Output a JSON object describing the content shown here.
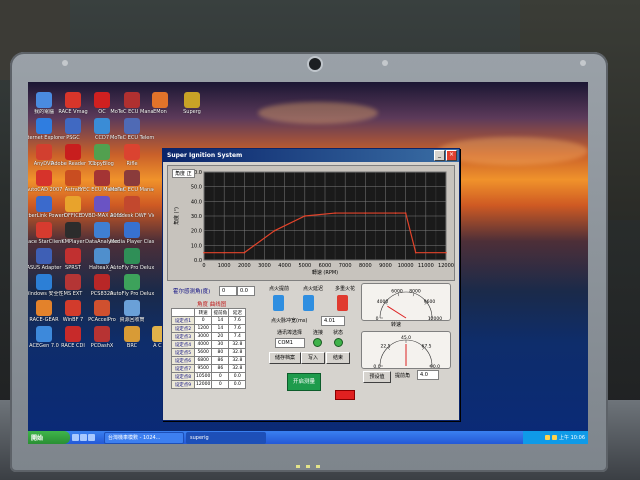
{
  "window": {
    "title": "Super Ignition System"
  },
  "chart_data": {
    "type": "line",
    "title": "",
    "xlabel": "轉速 (RPM)",
    "ylabel": "角度 (°)",
    "x_ticks": [
      "0",
      "1000",
      "2000",
      "3000",
      "4000",
      "5000",
      "6000",
      "7000",
      "8000",
      "9000",
      "10000",
      "11000",
      "12000"
    ],
    "y_ticks": [
      "0.0",
      "10.0",
      "20.0",
      "30.0",
      "40.0",
      "50.0",
      "60.0"
    ],
    "xlim": [
      0,
      12000
    ],
    "ylim": [
      0,
      60
    ],
    "grid": true,
    "series": [
      {
        "x": [
          0,
          1000,
          2000,
          3500,
          5000,
          6500,
          8000,
          9500,
          10000,
          10500,
          12000
        ],
        "y": [
          5,
          5,
          5,
          20,
          30,
          32,
          32,
          32,
          32,
          5,
          5
        ]
      }
    ],
    "legend_box": "角度 正"
  },
  "labels": {
    "sensor_angle": "霍尔感测角(度)",
    "sensor_value": "0",
    "sensor_value2": "0.0",
    "advance_curve": "角度  曲线图",
    "ignite_advance": "点火提前",
    "ignite_delay": "点火延迟",
    "spark_mode": "多重火花",
    "dwell_time": "点火脉冲宽(ms)",
    "dwell_value": "4.01",
    "port_select": "通讯埠选择",
    "port_value": "COM1",
    "connect": "连接",
    "status": "状态",
    "rpm_label": "转速",
    "advance_label": "提前角",
    "advance_value": "4.0"
  },
  "table": {
    "headers": [
      "",
      "转速",
      "提前角",
      "延迟"
    ],
    "rows": [
      [
        "设定点1",
        "0",
        "14",
        "7.6"
      ],
      [
        "设定点2",
        "1200",
        "14",
        "7.6"
      ],
      [
        "设定点3",
        "3000",
        "20",
        "7.4"
      ],
      [
        "设定点4",
        "4000",
        "30",
        "32.8"
      ],
      [
        "设定点5",
        "5600",
        "80",
        "32.8"
      ],
      [
        "设定点6",
        "6800",
        "86",
        "32.8"
      ],
      [
        "设定点7",
        "9500",
        "86",
        "32.8"
      ],
      [
        "设定点8",
        "10500",
        "0",
        "0.0"
      ],
      [
        "设定点9",
        "12000",
        "0",
        "0.0"
      ]
    ]
  },
  "buttons": {
    "open_file": "读取设定",
    "save_file": "储存档案",
    "write": "写入",
    "apply": "开启测量",
    "exit": "结束",
    "load_default": "预设值"
  },
  "gauge_top": {
    "label": "转速",
    "ticks": [
      "0",
      "4000",
      "6000",
      "8000",
      "9600",
      "12000"
    ],
    "value_fraction": 0.18
  },
  "gauge_bottom": {
    "label": "提前角",
    "ticks": [
      "0.0",
      "22.5",
      "45.0",
      "67.5",
      "90.0"
    ],
    "value_fraction": 0.5
  },
  "desktop_icons": [
    {
      "label": "我的電腦",
      "color": "#4a8be0"
    },
    {
      "label": "RACE Vmag",
      "color": "#d8352a"
    },
    {
      "label": "OC",
      "color": "#d02020"
    },
    {
      "label": "MoTeC ECU Mana",
      "color": "#b03030"
    },
    {
      "label": "EMon",
      "color": "#e2732a"
    },
    {
      "label": "Superg",
      "color": "#c9a226"
    },
    {
      "label": "Internet Explorer",
      "color": "#2f7de0"
    },
    {
      "label": "PSGC",
      "color": "#4069c2"
    },
    {
      "label": "CCD7",
      "color": "#3a8cd6"
    },
    {
      "label": "MoTeC ECU Telemtry",
      "color": "#4f6ab5"
    },
    {
      "label": "AnyDVD",
      "color": "#d23f2f"
    },
    {
      "label": "Adobe Reader 7.0",
      "color": "#c81e1e"
    },
    {
      "label": "CopyBlog",
      "color": "#52a04f"
    },
    {
      "label": "Rifle",
      "color": "#db4330"
    },
    {
      "label": "AutoCAD 2007",
      "color": "#d6332b"
    },
    {
      "label": "AstraB",
      "color": "#c94d20"
    },
    {
      "label": "YEC ECU Matching",
      "color": "#a43434"
    },
    {
      "label": "MoTeC ECU Manager",
      "color": "#8a3b3b"
    },
    {
      "label": "CyberLink PowerDVD",
      "color": "#3b6acc"
    },
    {
      "label": "OFFICE",
      "color": "#e8a32c"
    },
    {
      "label": "DVBD-MAX 2009",
      "color": "#6a53c4"
    },
    {
      "label": "Autodesk DWF Viewer",
      "color": "#c2482e"
    },
    {
      "label": "Race StarClient",
      "color": "#d63b2f"
    },
    {
      "label": "KMPlayer",
      "color": "#2c2c2c"
    },
    {
      "label": "DataAnalyzer",
      "color": "#3f7fd3"
    },
    {
      "label": "Media Player Classic",
      "color": "#3771d0"
    },
    {
      "label": "ASUS Adapter",
      "color": "#3e5fb5"
    },
    {
      "label": "SPRST",
      "color": "#c13030"
    },
    {
      "label": "HalteaX_V",
      "color": "#4f8fcd"
    },
    {
      "label": "AutoFly Pro Deluxe",
      "color": "#2f8f57"
    },
    {
      "label": "Windows 安全性",
      "color": "#2c7fd6"
    },
    {
      "label": "MS EXT",
      "color": "#b43535"
    },
    {
      "label": "PCS8320",
      "color": "#b82727"
    },
    {
      "label": "AutoFly Pro Deluxe Dos",
      "color": "#3da25b"
    },
    {
      "label": "RACE-GEAR",
      "color": "#e3822b"
    },
    {
      "label": "WinBF 7",
      "color": "#d23b2c"
    },
    {
      "label": "PCAccelPro",
      "color": "#d0502f"
    },
    {
      "label": "資源回收筒",
      "color": "#6aa0d8"
    },
    {
      "label": "ACEGen 7.0",
      "color": "#3d89db"
    },
    {
      "label": "RACE CDI",
      "color": "#c72a2a"
    },
    {
      "label": "PCDashX",
      "color": "#b73333"
    },
    {
      "label": "BRC",
      "color": "#d89b36"
    },
    {
      "label": "A CDI",
      "color": "#e0b24a"
    }
  ],
  "taskbar": {
    "start": "開始",
    "tasks": [
      "台灣機車模數 - 1024...",
      "superig"
    ],
    "clock": "上午 10:06"
  }
}
